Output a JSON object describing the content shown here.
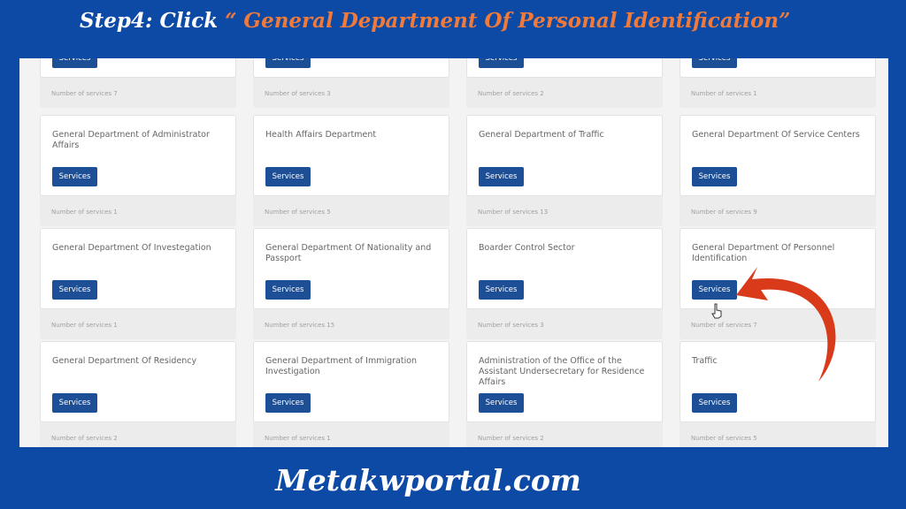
{
  "banner": {
    "prefix": "Step4: Click ",
    "highlight": "“ General Department Of Personal Identification”"
  },
  "footer": {
    "site": "Metakwportal.com"
  },
  "colors": {
    "background": "#0d4aa6",
    "highlight": "#f07a3a",
    "button": "#1d4f96",
    "arrow": "#d93a1a"
  },
  "button_label": "Services",
  "rows": [
    [
      {
        "title": "",
        "count": "Number of services 7"
      },
      {
        "title": "",
        "count": "Number of services 3"
      },
      {
        "title": "",
        "count": "Number of services 2"
      },
      {
        "title": "",
        "count": "Number of services 1"
      }
    ],
    [
      {
        "title": "General Department of Administrator Affairs",
        "count": "Number of services 1"
      },
      {
        "title": "Health Affairs Department",
        "count": "Number of services 5"
      },
      {
        "title": "General Department of Traffic",
        "count": "Number of services 13"
      },
      {
        "title": "General Department Of Service Centers",
        "count": "Number of services 9"
      }
    ],
    [
      {
        "title": "General Department Of Investegation",
        "count": "Number of services 1"
      },
      {
        "title": "General Department Of Nationality and Passport",
        "count": "Number of services 15"
      },
      {
        "title": "Boarder Control Sector",
        "count": "Number of services 3"
      },
      {
        "title": "General Department Of Personnel Identification",
        "count": "Number of services 7"
      }
    ],
    [
      {
        "title": "General Department Of Residency",
        "count": "Number of services 2"
      },
      {
        "title": "General Department of Immigration Investigation",
        "count": "Number of services 1"
      },
      {
        "title": "Administration of the Office of the Assistant Undersecretary for Residence Affairs",
        "count": "Number of services 2"
      },
      {
        "title": "Traffic",
        "count": "Number of services 5"
      }
    ]
  ]
}
